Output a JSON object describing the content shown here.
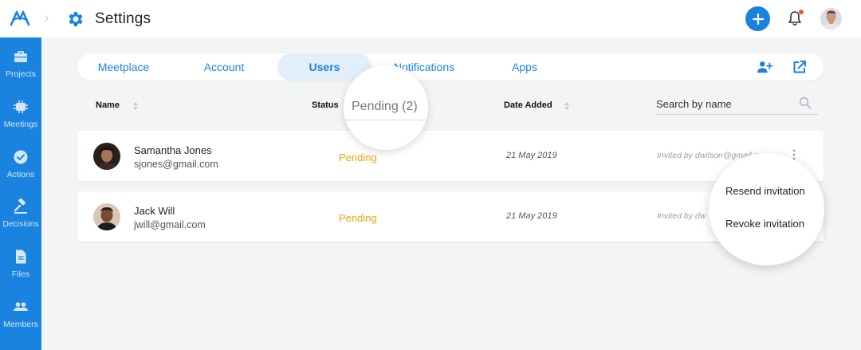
{
  "header": {
    "title": "Settings",
    "icons": {
      "logo": "brand-logo",
      "breadcrumb": "chevron-right-icon",
      "settings": "gear-icon",
      "add": "plus-icon",
      "notifications": "bell-icon",
      "avatar": "user-avatar"
    },
    "accent_color": "#1a83e0",
    "notification_dot_color": "#f24f3b"
  },
  "sidebar": {
    "color": "#1a83e0",
    "items": [
      {
        "label": "Projects",
        "icon": "briefcase-icon"
      },
      {
        "label": "Meetings",
        "icon": "meetings-icon"
      },
      {
        "label": "Actions",
        "icon": "check-circle-icon"
      },
      {
        "label": "Decisions",
        "icon": "gavel-icon"
      },
      {
        "label": "Files",
        "icon": "file-icon"
      },
      {
        "label": "Members",
        "icon": "people-icon"
      }
    ]
  },
  "tabs": {
    "items": [
      {
        "label": "Meetplace",
        "active": false
      },
      {
        "label": "Account",
        "active": false
      },
      {
        "label": "Users",
        "active": true
      },
      {
        "label": "Notifications",
        "active": false
      },
      {
        "label": "Apps",
        "active": false
      }
    ],
    "actions": {
      "add_user": "add-user-icon",
      "export": "export-icon"
    }
  },
  "table": {
    "columns": {
      "name": "Name",
      "status": "Status",
      "date_added": "Date Added"
    },
    "search_placeholder": "Search by name",
    "status_filter": "Pending (2)",
    "rows": [
      {
        "name": "Samantha Jones",
        "email": "sjones@gmail.com",
        "status": "Pending",
        "date": "21 May 2019",
        "invited_by": "Invited by dwilson@gmail.com"
      },
      {
        "name": "Jack Will",
        "email": "jwill@gmail.com",
        "status": "Pending",
        "date": "21 May 2019",
        "invited_by": "Invited by dw"
      }
    ],
    "status_color": "#e5a913"
  },
  "row_menu": {
    "items": [
      "Resend invitation",
      "Revoke invitation"
    ]
  }
}
